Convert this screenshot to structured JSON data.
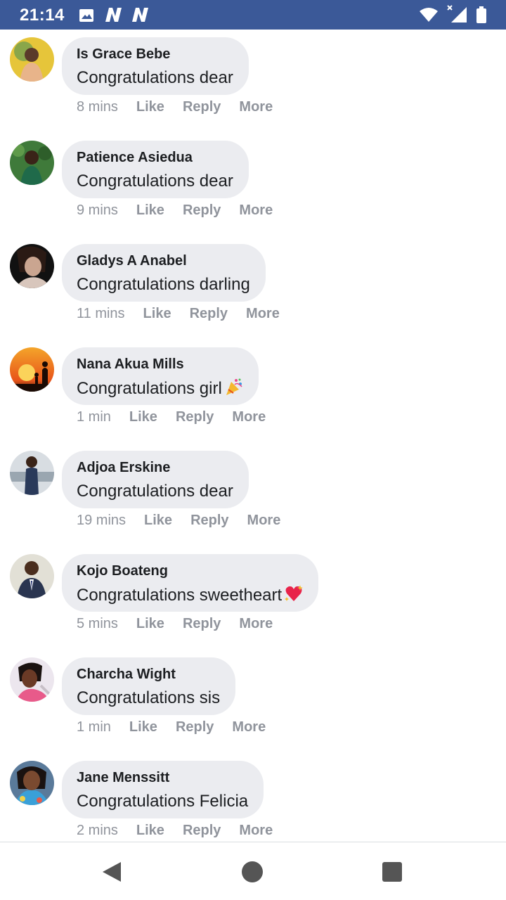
{
  "status_bar": {
    "time": "21:14",
    "icons": [
      "image-icon",
      "notification-n-icon",
      "notification-n-icon",
      "wifi-icon",
      "signal-icon",
      "battery-icon"
    ],
    "background": "#3b5998"
  },
  "comments": [
    {
      "author": "Is Grace Bebe",
      "text": "Congratulations dear",
      "time": "8 mins",
      "emoji": ""
    },
    {
      "author": "Patience Asiedua",
      "text": "Congratulations dear",
      "time": "9 mins",
      "emoji": ""
    },
    {
      "author": "Gladys A Anabel",
      "text": "Congratulations darling",
      "time": "11 mins",
      "emoji": ""
    },
    {
      "author": "Nana Akua Mills",
      "text": "Congratulations girl",
      "time": "1 min",
      "emoji": "party-popper"
    },
    {
      "author": "Adjoa Erskine",
      "text": "Congratulations dear",
      "time": "19 mins",
      "emoji": ""
    },
    {
      "author": "Kojo Boateng",
      "text": "Congratulations sweetheart",
      "time": "5 mins",
      "emoji": "sparkling-heart"
    },
    {
      "author": "Charcha Wight",
      "text": "Congratulations sis",
      "time": "1 min",
      "emoji": ""
    },
    {
      "author": "Jane Menssitt",
      "text": "Congratulations Felicia",
      "time": "2 mins",
      "emoji": ""
    }
  ],
  "actions": {
    "like": "Like",
    "reply": "Reply",
    "more": "More"
  },
  "nav_bar": {
    "icons": [
      "back-icon",
      "home-icon",
      "recents-icon"
    ]
  },
  "colors": {
    "bubble": "#ebecf0",
    "meta": "#90949c",
    "text": "#1c1e21"
  }
}
